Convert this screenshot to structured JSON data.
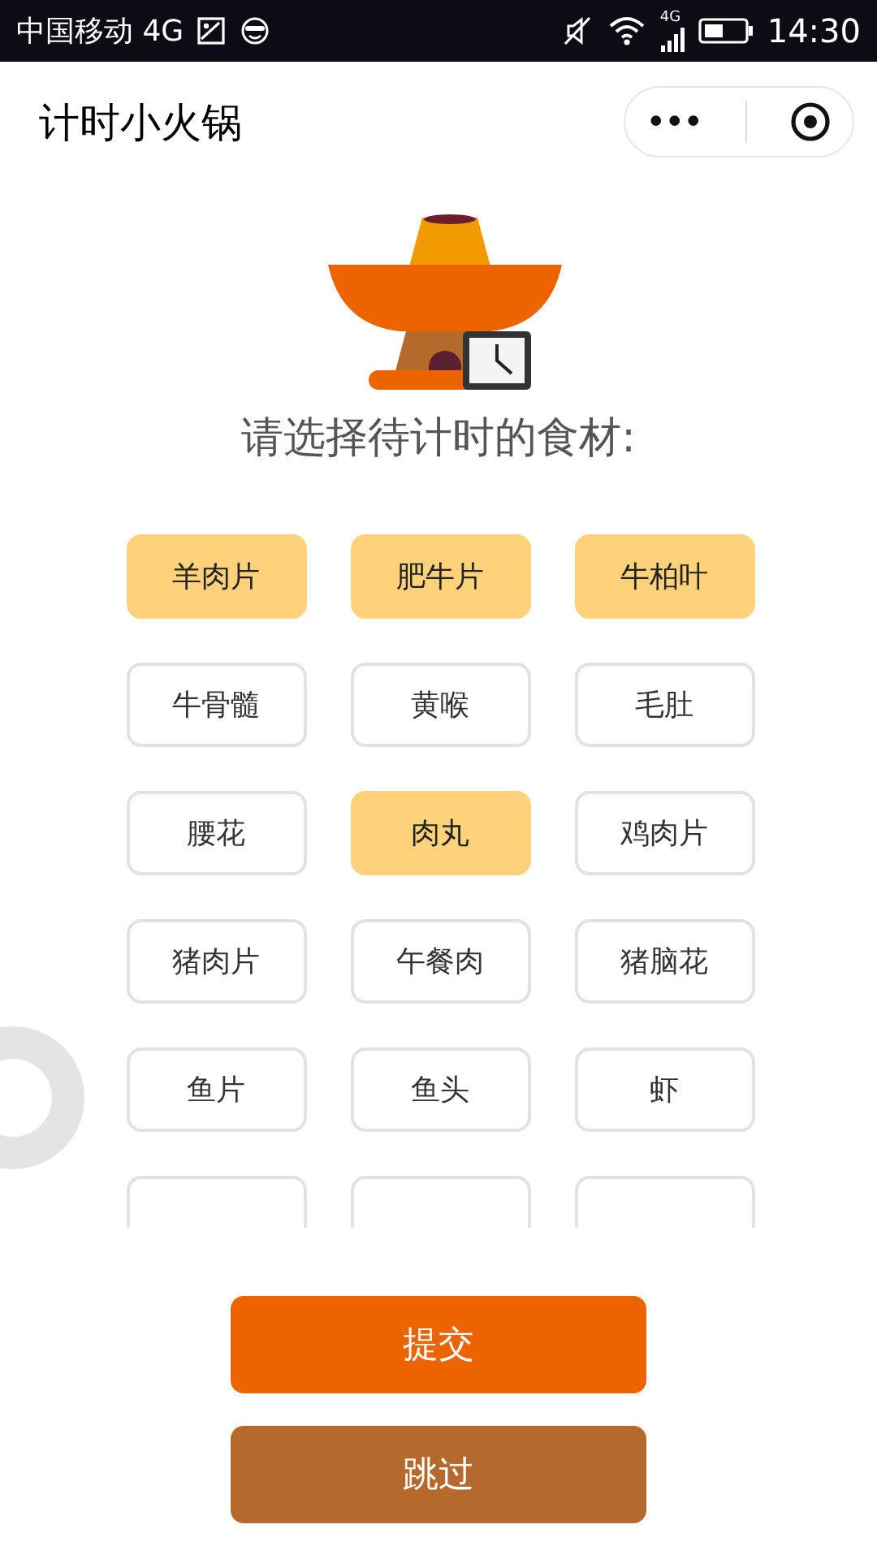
{
  "status_bar": {
    "carrier": "中国移动 4G",
    "network": "4G",
    "time": "14:30"
  },
  "nav": {
    "title": "计时小火锅",
    "more": "•••"
  },
  "prompt": "请选择待计时的食材:",
  "ingredients": [
    {
      "label": "羊肉片",
      "selected": true
    },
    {
      "label": "肥牛片",
      "selected": true
    },
    {
      "label": "牛柏叶",
      "selected": true
    },
    {
      "label": "牛骨髓",
      "selected": false
    },
    {
      "label": "黄喉",
      "selected": false
    },
    {
      "label": "毛肚",
      "selected": false
    },
    {
      "label": "腰花",
      "selected": false
    },
    {
      "label": "肉丸",
      "selected": true
    },
    {
      "label": "鸡肉片",
      "selected": false
    },
    {
      "label": "猪肉片",
      "selected": false
    },
    {
      "label": "午餐肉",
      "selected": false
    },
    {
      "label": "猪脑花",
      "selected": false
    },
    {
      "label": "鱼片",
      "selected": false
    },
    {
      "label": "鱼头",
      "selected": false
    },
    {
      "label": "虾",
      "selected": false
    }
  ],
  "cut_off_items": [
    {
      "kind": "chip"
    },
    {
      "kind": "chip"
    },
    {
      "kind": "chip"
    }
  ],
  "buttons": [
    {
      "label": "提交",
      "kind": "primary"
    },
    {
      "label": "跳过",
      "kind": "secondary"
    }
  ]
}
